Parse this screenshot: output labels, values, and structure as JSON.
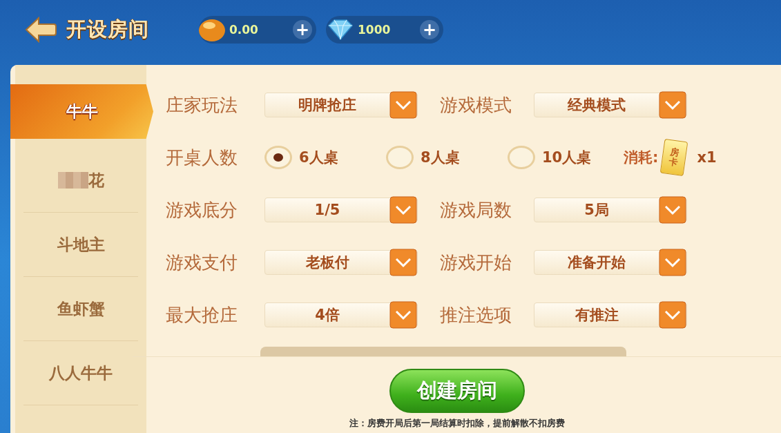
{
  "header": {
    "title": "开设房间",
    "currencies": [
      {
        "kind": "bean",
        "amount": "0.00",
        "add": "+"
      },
      {
        "kind": "diamond",
        "amount": "1000",
        "add": "+"
      }
    ]
  },
  "sidebar": {
    "items": [
      {
        "label": "牛牛",
        "selected": true,
        "masked": false
      },
      {
        "label": "花",
        "selected": false,
        "masked": true
      },
      {
        "label": "斗地主",
        "selected": false,
        "masked": false
      },
      {
        "label": "鱼虾蟹",
        "selected": false,
        "masked": false
      },
      {
        "label": "八人牛牛",
        "selected": false,
        "masked": false
      }
    ]
  },
  "form": {
    "rows": [
      {
        "kind": "selects",
        "fields": [
          {
            "label": "庄家玩法",
            "value": "明牌抢庄"
          },
          {
            "label": "游戏模式",
            "value": "经典模式"
          }
        ]
      },
      {
        "kind": "radio",
        "label": "开桌人数",
        "options": [
          {
            "label": "6人桌",
            "selected": true
          },
          {
            "label": "8人桌",
            "selected": false
          },
          {
            "label": "10人桌",
            "selected": false
          }
        ],
        "cost": {
          "label": "消耗:",
          "card": "房卡",
          "count": "x1"
        }
      },
      {
        "kind": "selects",
        "fields": [
          {
            "label": "游戏底分",
            "value": "1/5"
          },
          {
            "label": "游戏局数",
            "value": "5局"
          }
        ]
      },
      {
        "kind": "selects",
        "fields": [
          {
            "label": "游戏支付",
            "value": "老板付"
          },
          {
            "label": "游戏开始",
            "value": "准备开始"
          }
        ]
      },
      {
        "kind": "selects",
        "fields": [
          {
            "label": "最大抢庄",
            "value": "4倍"
          },
          {
            "label": "推注选项",
            "value": "有推注"
          }
        ]
      }
    ]
  },
  "footer": {
    "button": "创建房间",
    "note": "注：房费开局后第一局结算时扣除，提前解散不扣房费"
  }
}
